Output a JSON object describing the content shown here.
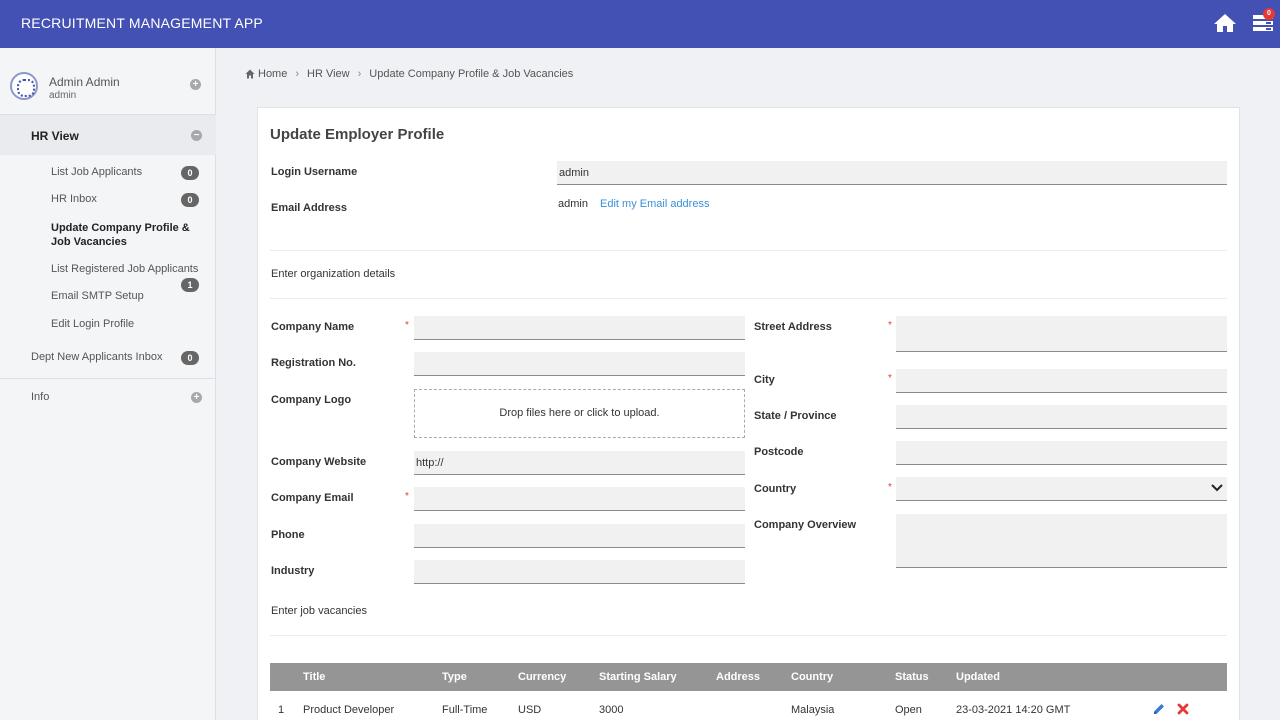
{
  "app": {
    "title": "RECRUITMENT MANAGEMENT APP",
    "notifications": "0",
    "icons": {
      "home": "home-icon",
      "tray": "inbox-tray-icon"
    },
    "accent_color": "#4451b4"
  },
  "user": {
    "name": "Admin Admin",
    "role": "admin"
  },
  "sidebar": {
    "section": "HR View",
    "items": [
      {
        "label": "List Job Applicants",
        "count": "0"
      },
      {
        "label": "HR Inbox",
        "count": "0"
      },
      {
        "label": "Update Company Profile & Job Vacancies"
      },
      {
        "label": "List Registered Job Applicants",
        "count": "1"
      },
      {
        "label": "Email SMTP Setup"
      },
      {
        "label": "Edit Login Profile"
      }
    ],
    "dept_inbox": {
      "label": "Dept New Applicants Inbox",
      "count": "0"
    },
    "info": "Info"
  },
  "breadcrumb": {
    "home": "Home",
    "hr_view": "HR View",
    "current": "Update Company Profile & Job Vacancies"
  },
  "form": {
    "title": "Update Employer Profile",
    "login_username_label": "Login Username",
    "login_username_value": "admin",
    "email_label": "Email Address",
    "email_value": "admin",
    "email_edit_link": "Edit my Email address",
    "org_section": "Enter organization details",
    "company_name_label": "Company Name",
    "registration_label": "Registration No.",
    "logo_label": "Company Logo",
    "dropzone_text": "Drop files here or click to upload.",
    "website_label": "Company Website",
    "website_value": "http://",
    "company_email_label": "Company Email",
    "phone_label": "Phone",
    "industry_label": "Industry",
    "street_label": "Street Address",
    "city_label": "City",
    "state_label": "State / Province",
    "postcode_label": "Postcode",
    "country_label": "Country",
    "overview_label": "Company Overview",
    "required_mark": "*",
    "jobs_section": "Enter job vacancies"
  },
  "jobs_table": {
    "columns": [
      "Title",
      "Type",
      "Currency",
      "Starting Salary",
      "Address",
      "Country",
      "Status",
      "Updated"
    ],
    "rows": [
      {
        "no": "1",
        "title": "Product Developer",
        "type": "Full-Time",
        "currency": "USD",
        "salary": "3000",
        "address": "",
        "country": "Malaysia",
        "status": "Open",
        "updated": "23-03-2021 14:20 GMT"
      }
    ]
  }
}
